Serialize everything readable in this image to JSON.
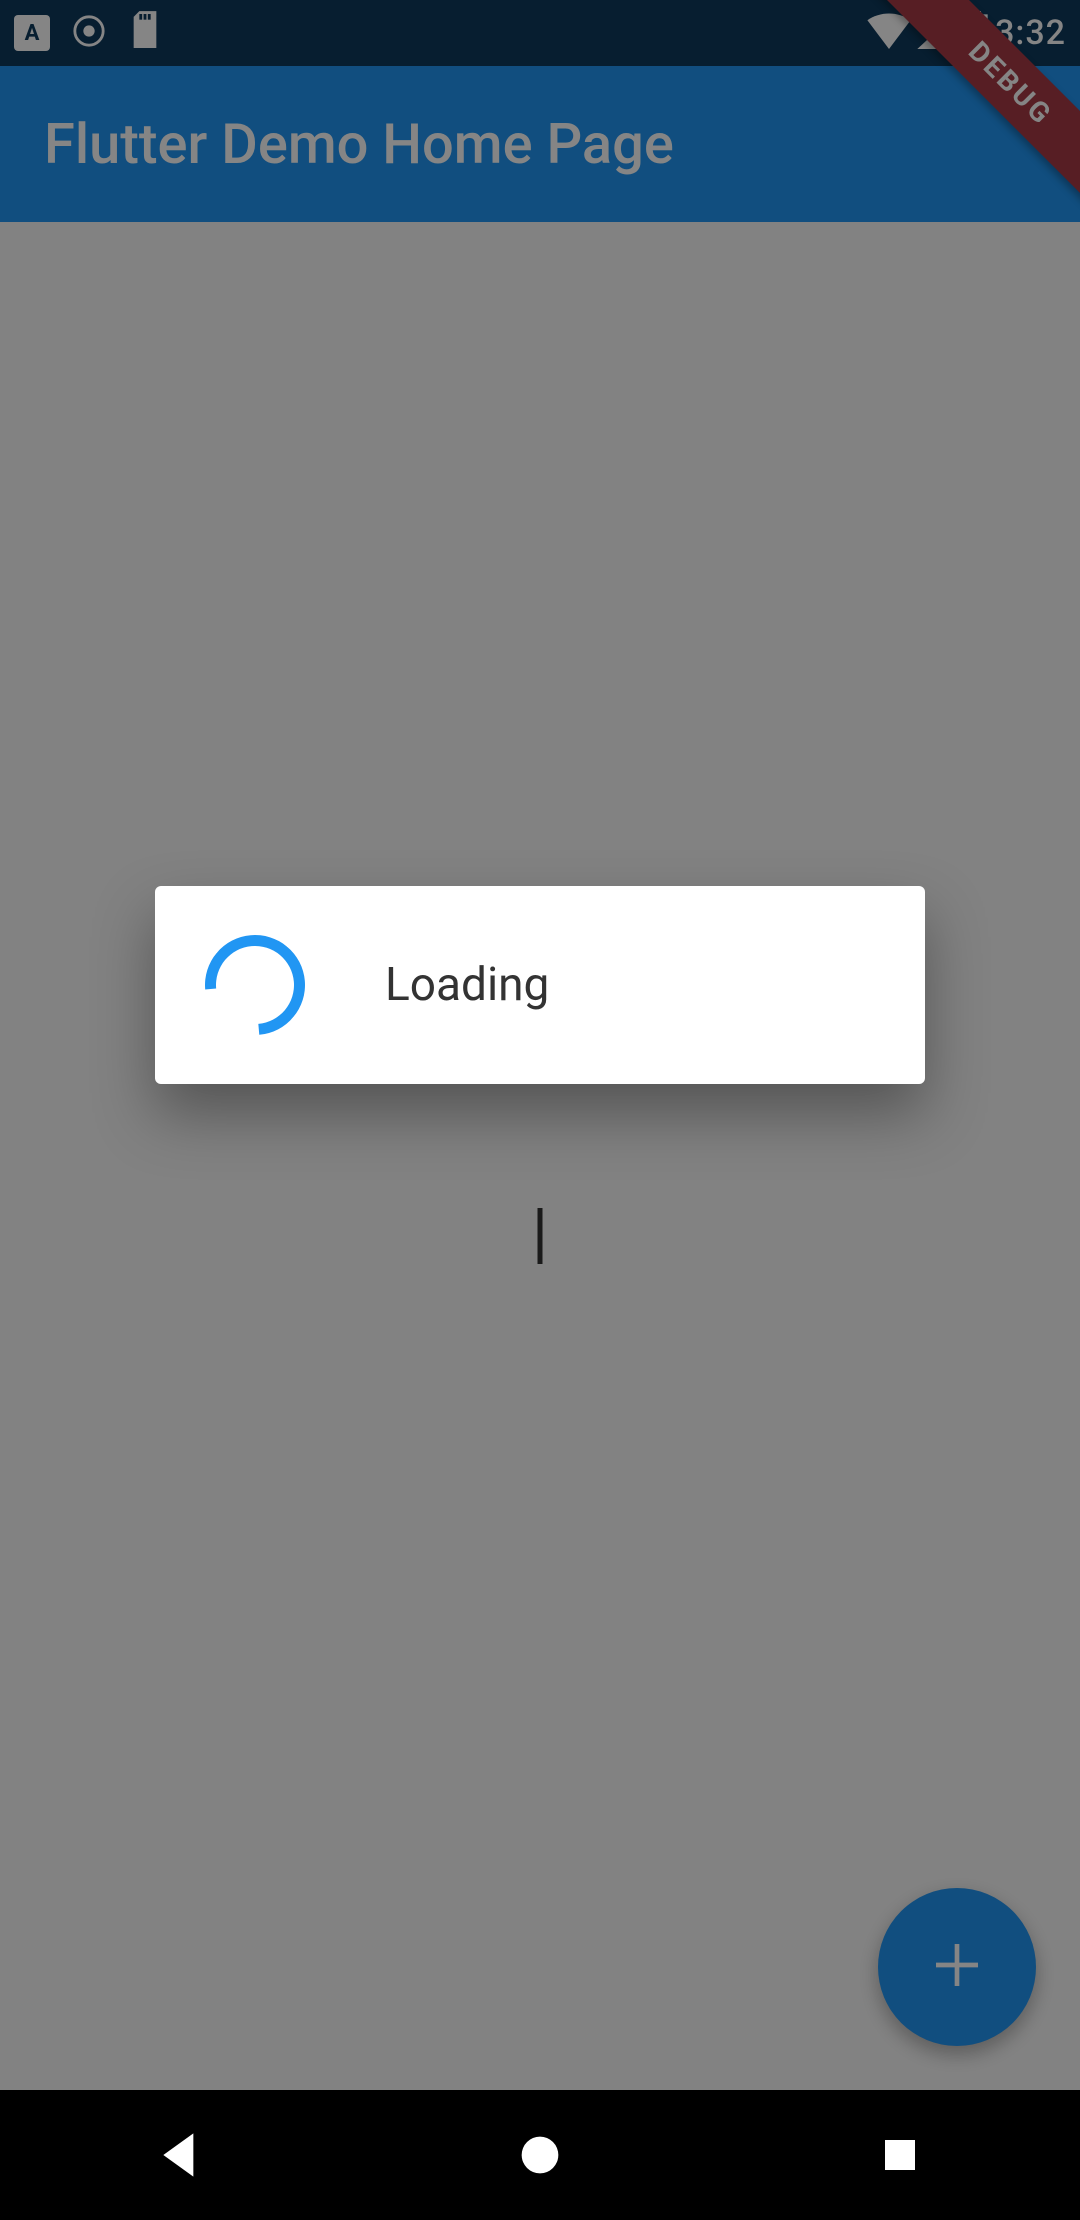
{
  "statusbar": {
    "time": "3:32"
  },
  "appbar": {
    "title": "Flutter Demo Home Page"
  },
  "debug_ribbon": "DEBUG",
  "dialog": {
    "message": "Loading"
  },
  "fab": {
    "icon": "plus"
  }
}
